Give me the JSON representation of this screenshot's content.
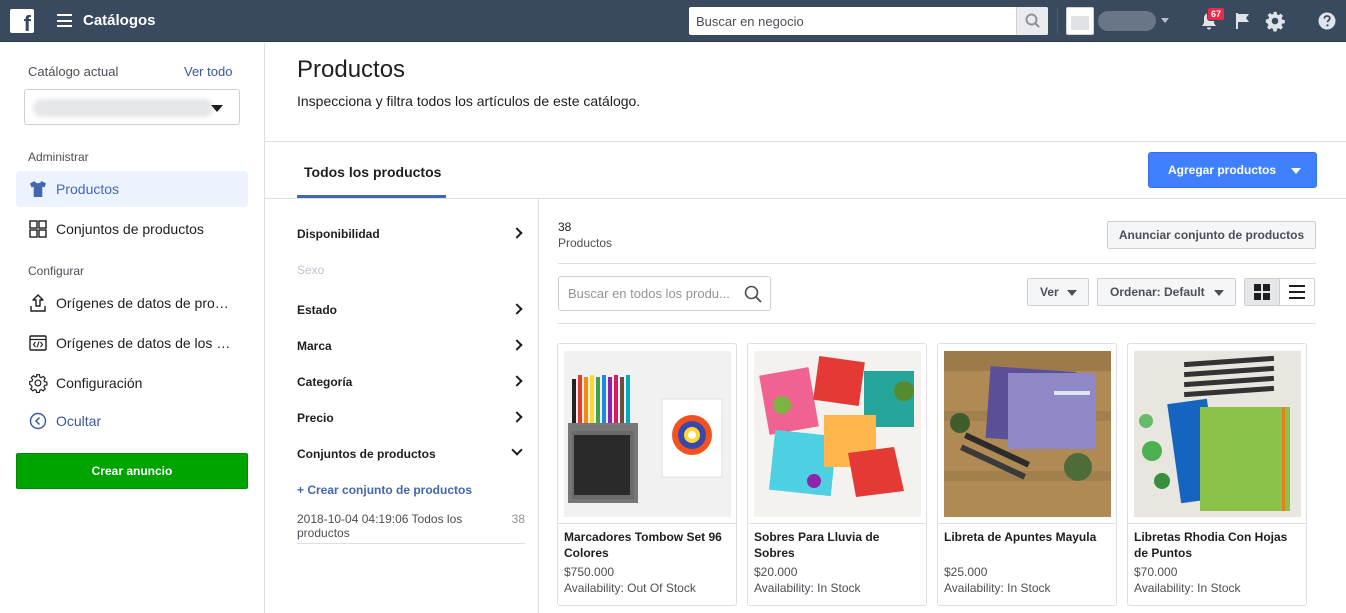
{
  "topbar": {
    "logo": "facebook-logo",
    "title": "Catálogos",
    "search_placeholder": "Buscar en negocio",
    "notifications_count": "67"
  },
  "sidebar": {
    "catalog_label": "Catálogo actual",
    "see_all": "Ver todo",
    "section_manage": "Administrar",
    "section_configure": "Configurar",
    "items": [
      {
        "label": "Productos",
        "icon": "shirt-icon"
      },
      {
        "label": "Conjuntos de productos",
        "icon": "grid-icon"
      },
      {
        "label": "Orígenes de datos de productos",
        "icon": "upload-icon"
      },
      {
        "label": "Orígenes de datos de los eventos",
        "icon": "code-icon"
      },
      {
        "label": "Configuración",
        "icon": "gear-icon"
      },
      {
        "label": "Ocultar",
        "icon": "chevron-left-circle-icon"
      }
    ],
    "create_ad": "Crear anuncio"
  },
  "header": {
    "title": "Productos",
    "subtitle": "Inspecciona y filtra todos los artículos de este catálogo.",
    "tab": "Todos los productos",
    "add_products": "Agregar productos"
  },
  "filters": {
    "items": [
      {
        "label": "Disponibilidad",
        "state": "collapsed"
      },
      {
        "label": "Sexo",
        "state": "disabled"
      },
      {
        "label": "Estado",
        "state": "collapsed"
      },
      {
        "label": "Marca",
        "state": "collapsed"
      },
      {
        "label": "Categoría",
        "state": "collapsed"
      },
      {
        "label": "Precio",
        "state": "collapsed"
      },
      {
        "label": "Conjuntos de productos",
        "state": "expanded"
      }
    ],
    "create_set": "+ Crear conjunto de productos",
    "set_name": "2018-10-04 04:19:06 Todos los productos",
    "set_count": "38"
  },
  "products_area": {
    "count": "38",
    "count_label": "Productos",
    "promote_set": "Anunciar conjunto de productos",
    "search_placeholder": "Buscar en todos los produ...",
    "view_label": "Ver",
    "sort_label": "Ordenar: Default"
  },
  "products": [
    {
      "title": "Marcadores Tombow Set 96 Colores",
      "price": "$750.000",
      "availability": "Availability: Out Of Stock"
    },
    {
      "title": "Sobres Para Lluvia de Sobres",
      "price": "$20.000",
      "availability": "Availability: In Stock"
    },
    {
      "title": "Libreta de Apuntes Mayula",
      "price": "$25.000",
      "availability": "Availability: In Stock"
    },
    {
      "title": "Libretas Rhodia Con Hojas de Puntos",
      "price": "$70.000",
      "availability": "Availability: In Stock"
    }
  ],
  "colors": {
    "topbar": "#394a5e",
    "accent": "#4267b2",
    "primary_button": "#4080ff",
    "create_button": "#00a400",
    "notification_badge": "#f02849"
  }
}
